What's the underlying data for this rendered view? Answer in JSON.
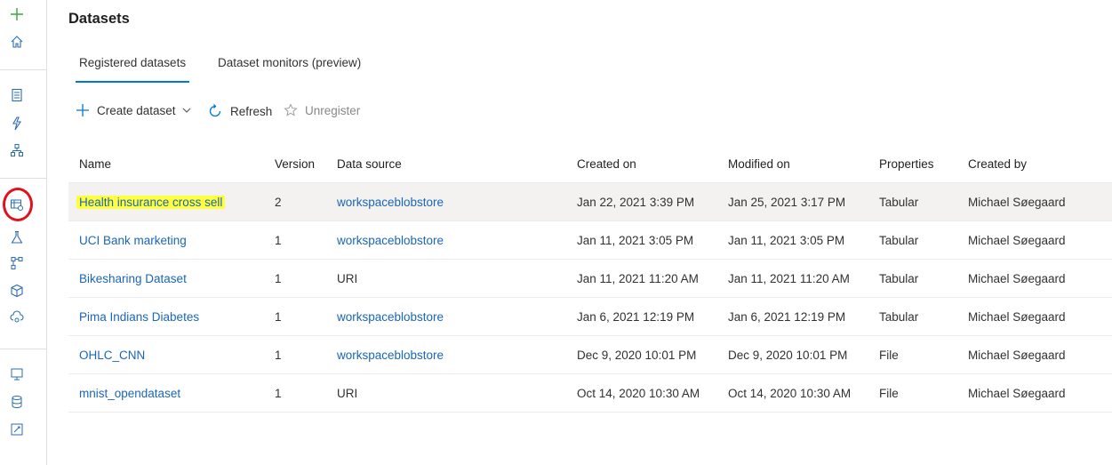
{
  "rail": {
    "icons": [
      "plus-icon",
      "home-icon",
      "notebook-icon",
      "automl-icon",
      "designer-icon",
      "datasets-icon",
      "experiments-icon",
      "pipelines-icon",
      "models-icon",
      "endpoints-icon",
      "compute-icon",
      "datastores-icon",
      "data-labeling-icon"
    ]
  },
  "page": {
    "title": "Datasets"
  },
  "tabs": [
    {
      "label": "Registered datasets",
      "active": true
    },
    {
      "label": "Dataset monitors (preview)",
      "active": false
    }
  ],
  "toolbar": {
    "create_label": "Create dataset",
    "refresh_label": "Refresh",
    "unregister_label": "Unregister"
  },
  "table": {
    "columns": [
      "Name",
      "Version",
      "Data source",
      "Created on",
      "Modified on",
      "Properties",
      "Created by"
    ],
    "rows": [
      {
        "name": "Health insurance cross sell",
        "version": "2",
        "source": "workspaceblobstore",
        "created": "Jan 22, 2021 3:39 PM",
        "modified": "Jan 25, 2021 3:17 PM",
        "properties": "Tabular",
        "by": "Michael Søegaard"
      },
      {
        "name": "UCI Bank marketing",
        "version": "1",
        "source": "workspaceblobstore",
        "created": "Jan 11, 2021 3:05 PM",
        "modified": "Jan 11, 2021 3:05 PM",
        "properties": "Tabular",
        "by": "Michael Søegaard"
      },
      {
        "name": "Bikesharing Dataset",
        "version": "1",
        "source": "URI",
        "created": "Jan 11, 2021 11:20 AM",
        "modified": "Jan 11, 2021 11:20 AM",
        "properties": "Tabular",
        "by": "Michael Søegaard"
      },
      {
        "name": "Pima Indians Diabetes",
        "version": "1",
        "source": "workspaceblobstore",
        "created": "Jan 6, 2021 12:19 PM",
        "modified": "Jan 6, 2021 12:19 PM",
        "properties": "Tabular",
        "by": "Michael Søegaard"
      },
      {
        "name": "OHLC_CNN",
        "version": "1",
        "source": "workspaceblobstore",
        "created": "Dec 9, 2020 10:01 PM",
        "modified": "Dec 9, 2020 10:01 PM",
        "properties": "File",
        "by": "Michael Søegaard"
      },
      {
        "name": "mnist_opendataset",
        "version": "1",
        "source": "URI",
        "created": "Oct 14, 2020 10:30 AM",
        "modified": "Oct 14, 2020 10:30 AM",
        "properties": "File",
        "by": "Michael Søegaard"
      }
    ]
  },
  "colors": {
    "accent": "#0078d4",
    "link": "#1a66b8",
    "highlight": "#ffff3d",
    "annotation": "#e0101d"
  }
}
